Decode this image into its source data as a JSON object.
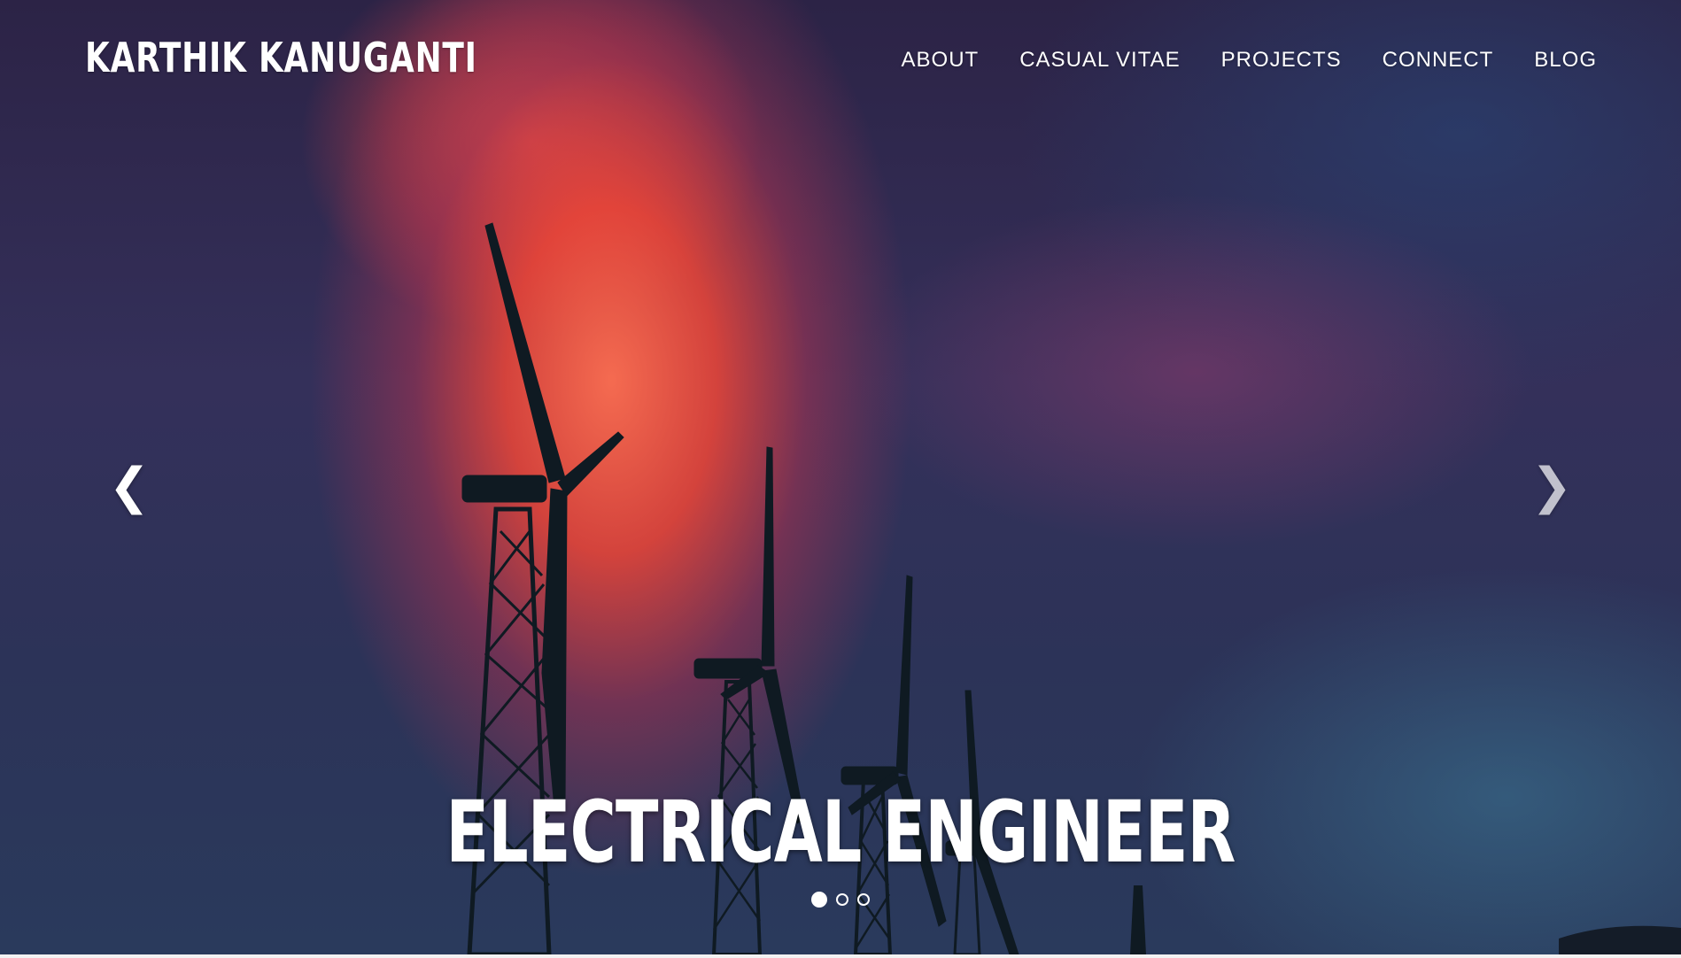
{
  "brand": {
    "name": "KARTHIK KANUGANTI"
  },
  "nav": {
    "items": [
      {
        "label": "ABOUT"
      },
      {
        "label": "CASUAL VITAE"
      },
      {
        "label": "PROJECTS"
      },
      {
        "label": "CONNECT"
      },
      {
        "label": "BLOG"
      }
    ]
  },
  "carousel": {
    "caption": "ELECTRICAL ENGINEER",
    "prev_icon": "chevron-left-icon",
    "next_icon": "chevron-right-icon",
    "slide_count": 3,
    "active_slide": 1
  },
  "colors": {
    "text": "#ffffff",
    "cloud_red": "#f04a3a",
    "sky_blue": "#2a3a5c",
    "sky_purple": "#34305a"
  }
}
